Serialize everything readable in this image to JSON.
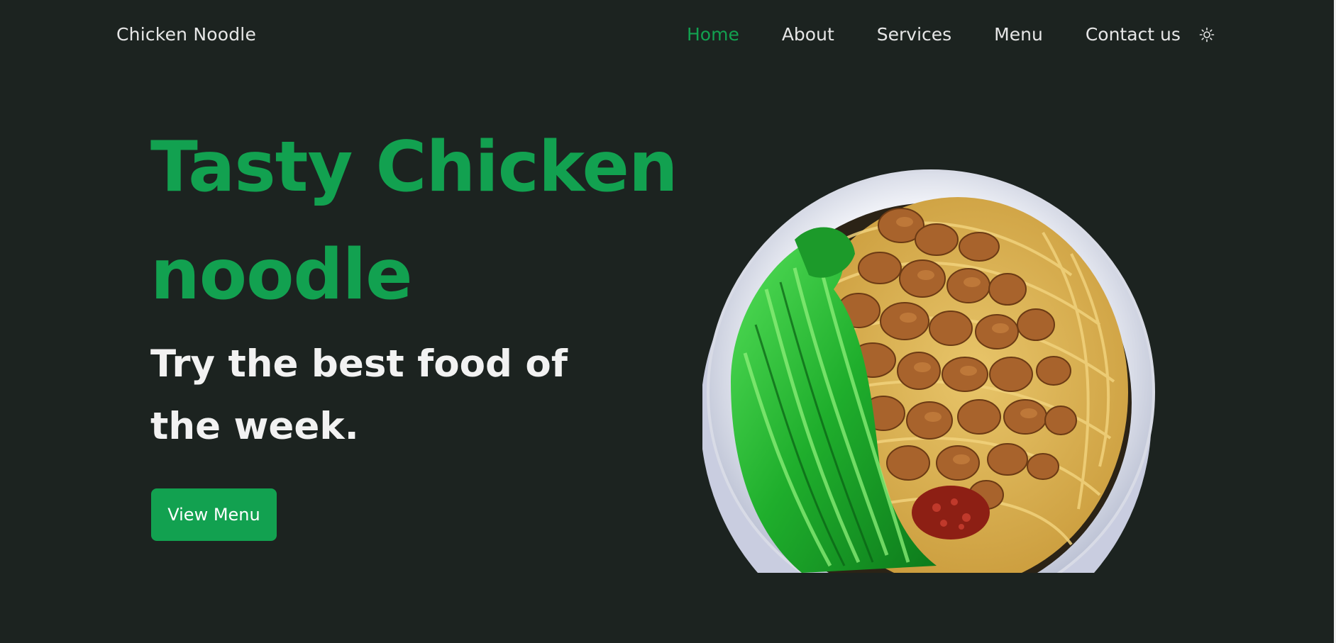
{
  "header": {
    "brand": "Chicken Noodle",
    "nav": [
      {
        "label": "Home",
        "active": true
      },
      {
        "label": "About",
        "active": false
      },
      {
        "label": "Services",
        "active": false
      },
      {
        "label": "Menu",
        "active": false
      },
      {
        "label": "Contact us",
        "active": false
      }
    ],
    "theme_toggle_icon": "sun-icon"
  },
  "hero": {
    "title": "Tasty Chicken noodle",
    "subtitle": "Try the best food of the week.",
    "cta_label": "View Menu",
    "image_icon": "chicken-noodle-bowl-image"
  },
  "colors": {
    "background": "#1c2320",
    "accent": "#12a150",
    "text": "#f2f2f2"
  }
}
